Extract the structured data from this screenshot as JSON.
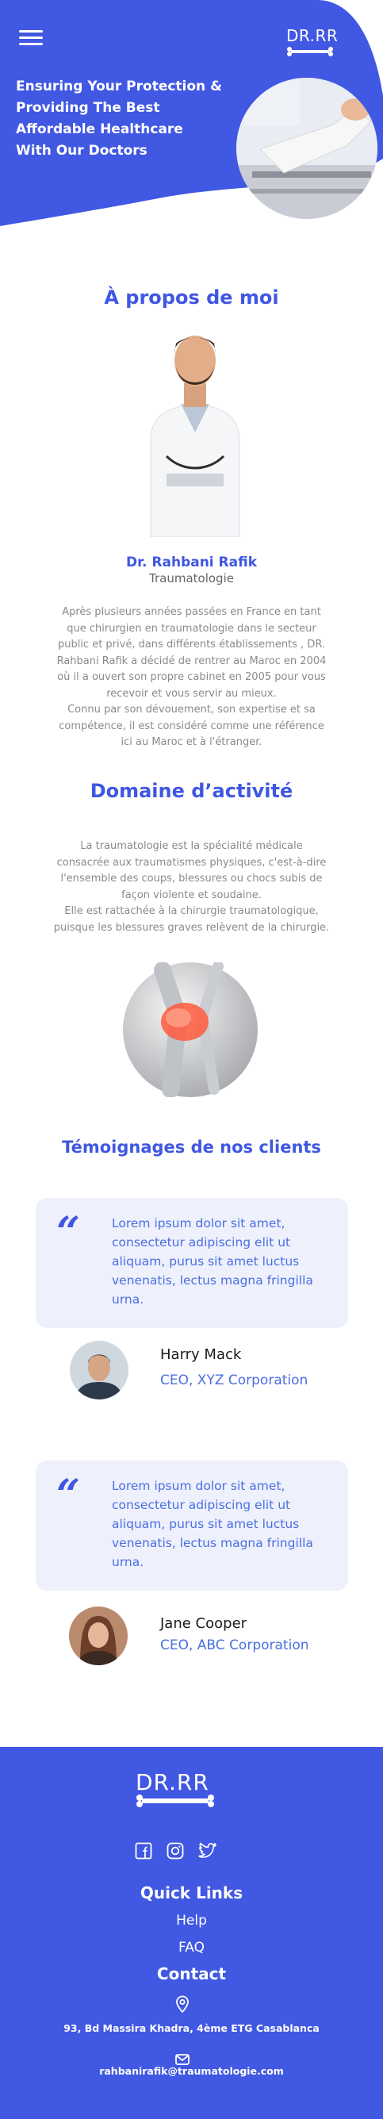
{
  "colors": {
    "primary": "#3f57e1",
    "footer_bg": "#4158e3",
    "card_bg": "#eef0fc",
    "accent_text": "#4a6fe0"
  },
  "header": {
    "menu_icon": "hamburger-menu-icon",
    "logo_text": "DR.RR",
    "hero_title": "Ensuring Your Protection & Providing The Best Affordable Healthcare With Our Doctors"
  },
  "about": {
    "title": "À propos de moi",
    "doctor_name": "Dr. Rahbani Rafik",
    "specialty": "Traumatologie",
    "bio": "Après  plusieurs  années passées en France  en  tant\nque  chirurgien en  traumatologie dans le secteur\npublic et privé,  dans différents établissements , DR.\nRahbani Rafik a décidé de rentrer au Maroc en 2004\noù il a ouvert son propre cabinet en 2005 pour vous\nrecevoir et vous servir au mieux.\nConnu par son dévouement, son expertise et sa\ncompétence, il est considéré comme une référence\nici au Maroc  et à l'étranger."
  },
  "activity": {
    "title": "Domaine d’activité",
    "text": "La traumatologie est la spécialité médicale\nconsacrée aux traumatismes physiques, c'est-à-dire\nl'ensemble des  coups, blessures ou chocs subis de\nfaçon violente et soudaine.\nElle  est rattachée à la chirurgie traumatologique,\npuisque les blessures graves relèvent de la chirurgie."
  },
  "testimonials": {
    "title": "Témoignages de nos clients",
    "items": [
      {
        "quote": "Lorem ipsum dolor sit amet, consectetur adipiscing elit ut aliquam, purus sit amet luctus venenatis, lectus magna fringilla urna.",
        "name": "Harry Mack",
        "role": "CEO, XYZ Corporation"
      },
      {
        "quote": "Lorem ipsum dolor sit amet, consectetur adipiscing elit ut aliquam, purus sit amet luctus venenatis, lectus magna fringilla urna.",
        "name": "Jane Cooper",
        "role": "CEO, ABC Corporation"
      }
    ]
  },
  "footer": {
    "logo_text": "DR.RR",
    "socials": [
      "facebook-icon",
      "instagram-icon",
      "twitter-icon"
    ],
    "quick_links_title": "Quick Links",
    "links": [
      "Help",
      "FAQ"
    ],
    "contact_title": "Contact",
    "address": "93, Bd Massira Khadra, 4ème ETG Casablanca",
    "email": "rahbanirafik@traumatologie.com"
  }
}
